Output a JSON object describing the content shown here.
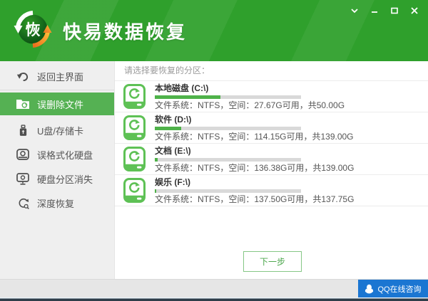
{
  "colors": {
    "header_green": "#2fa02c",
    "accent_green": "#55b153",
    "drive_icon_green": "#5ec155",
    "progress_green": "#4fb24a",
    "progress_track": "#d9d9d9",
    "qq_blue": "#1b76d2"
  },
  "header": {
    "logo_char": "恢",
    "title": "快易数据恢复",
    "controls": [
      "chevron-down",
      "minimize",
      "maximize",
      "close"
    ]
  },
  "sidebar": {
    "items": [
      {
        "label": "返回主界面",
        "icon": "back-arrow",
        "selected": false
      },
      {
        "label": "误删除文件",
        "icon": "folder-restore",
        "selected": true
      },
      {
        "label": "U盘/存储卡",
        "icon": "usb-drive",
        "selected": false
      },
      {
        "label": "误格式化硬盘",
        "icon": "hard-drive",
        "selected": false
      },
      {
        "label": "硬盘分区消失",
        "icon": "partition-lost",
        "selected": false
      },
      {
        "label": "深度恢复",
        "icon": "deep-recovery",
        "selected": false
      }
    ]
  },
  "main": {
    "prompt": "请选择要恢复的分区：",
    "partitions": [
      {
        "name": "本地磁盘 (C:\\)",
        "details": "文件系统：NTFS，空间：27.67G可用，共50.00G",
        "used_percent": 45
      },
      {
        "name": "软件 (D:\\)",
        "details": "文件系统：NTFS，空间：114.15G可用，共139.00G",
        "used_percent": 18
      },
      {
        "name": "文档 (E:\\)",
        "details": "文件系统：NTFS，空间：136.38G可用，共139.00G",
        "used_percent": 2
      },
      {
        "name": "娱乐 (F:\\)",
        "details": "文件系统：NTFS，空间：137.50G可用，共137.75G",
        "used_percent": 1
      }
    ],
    "next_button": "下一步"
  },
  "footer": {
    "qq_button": "QQ在线咨询"
  }
}
